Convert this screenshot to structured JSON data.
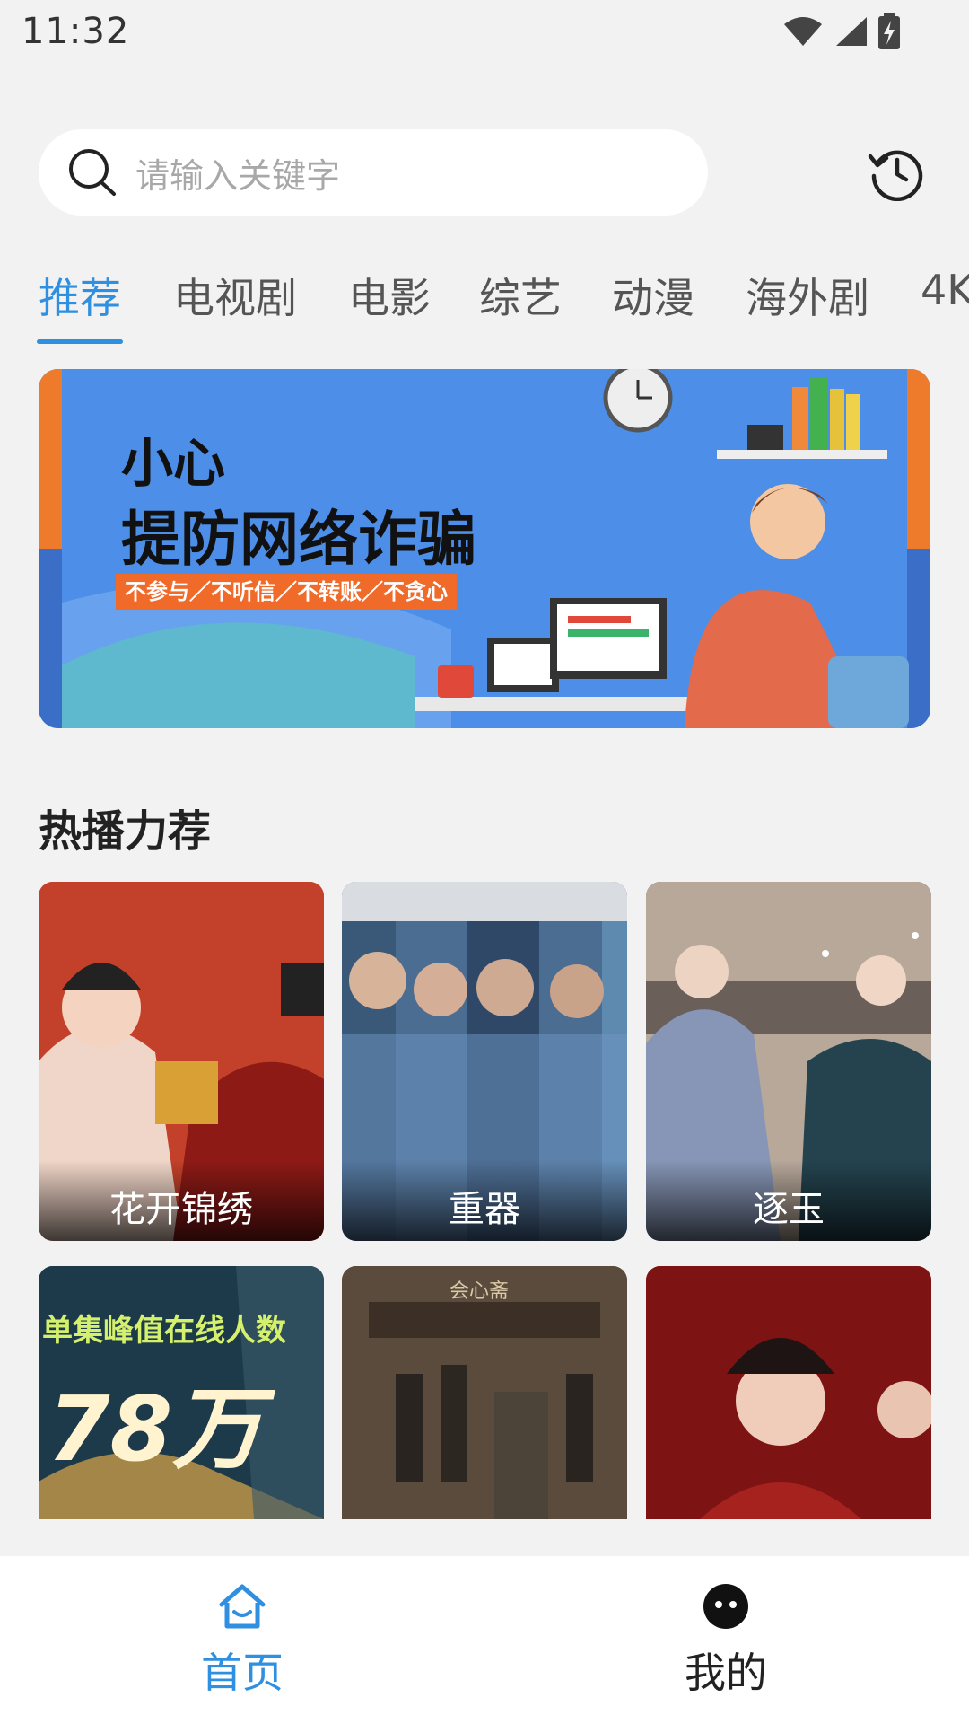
{
  "status_bar": {
    "time": "11:32",
    "icons": [
      "wifi-icon",
      "signal-icon",
      "battery-charging-icon"
    ]
  },
  "search": {
    "placeholder": "请输入关键字",
    "icon": "search-icon"
  },
  "history_icon": "history-clock-icon",
  "tabs": [
    {
      "label": "推荐",
      "active": true
    },
    {
      "label": "电视剧",
      "active": false
    },
    {
      "label": "电影",
      "active": false
    },
    {
      "label": "综艺",
      "active": false
    },
    {
      "label": "动漫",
      "active": false
    },
    {
      "label": "海外剧",
      "active": false
    },
    {
      "label": "4K",
      "active": false
    }
  ],
  "banner": {
    "line1": "小心",
    "line2": "提防网络诈骗",
    "tagline": "不参与／不听信／不转账／不贪心"
  },
  "section": {
    "title": "热播力荐"
  },
  "cards_row1": [
    {
      "title": "花开锦绣"
    },
    {
      "title": "重器"
    },
    {
      "title": "逐玉"
    }
  ],
  "cards_row2": [
    {
      "overlay_text_1": "单集峰值在线人数",
      "overlay_text_2": "78万"
    },
    {
      "overlay_text_1": "会心斋"
    },
    {}
  ],
  "bottom_nav": {
    "home_label": "首页",
    "mine_label": "我的"
  },
  "colors": {
    "accent": "#2f8fe0",
    "background": "#f2f2f2"
  }
}
